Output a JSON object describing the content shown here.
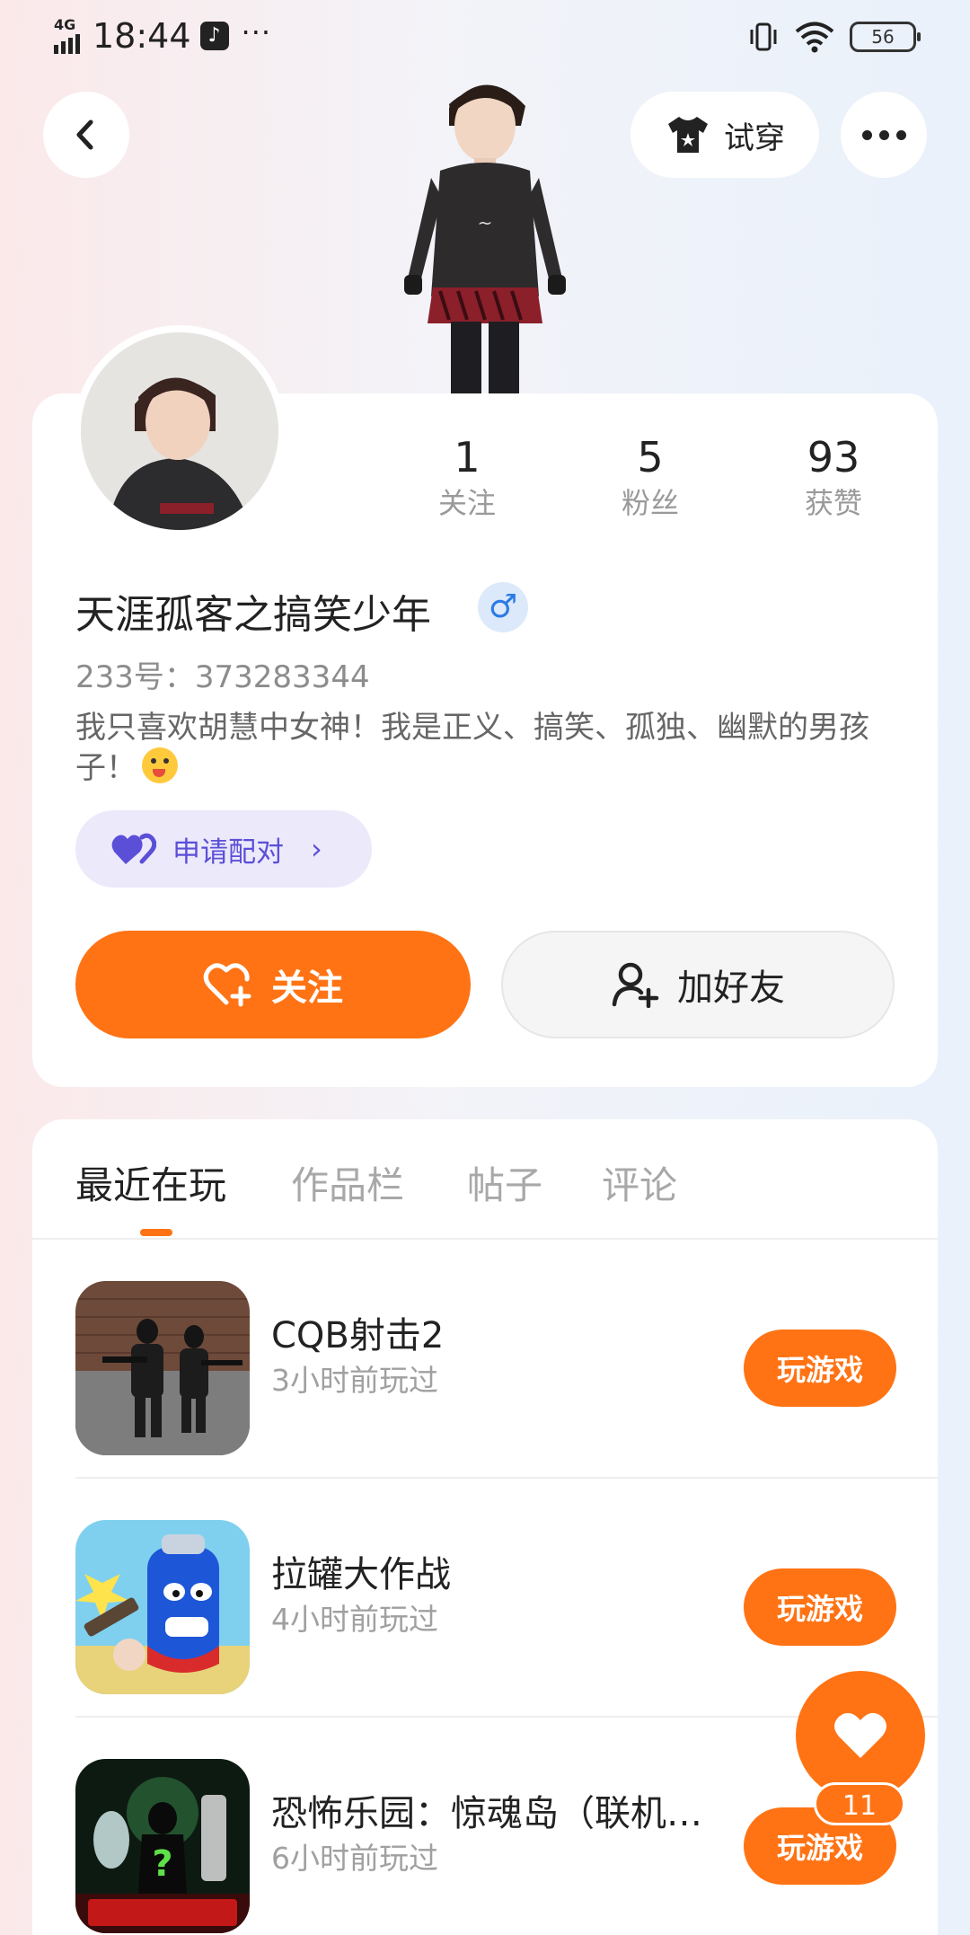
{
  "status_bar": {
    "network": "4G",
    "time": "18:44",
    "dots": "···",
    "battery": "56",
    "icons": [
      "signal-icon",
      "tiktok-icon",
      "vibrate-icon",
      "wifi-icon",
      "battery-icon"
    ]
  },
  "header": {
    "tryon_label": "试穿",
    "icons": [
      "back-arrow-icon",
      "tshirt-icon",
      "more-icon"
    ]
  },
  "profile": {
    "stats": [
      {
        "value": "1",
        "label": "关注"
      },
      {
        "value": "5",
        "label": "粉丝"
      },
      {
        "value": "93",
        "label": "获赞"
      }
    ],
    "username": "天涯孤客之搞笑少年",
    "gender_symbol": "♂",
    "uid": "233号：373283344",
    "bio": "我只喜欢胡慧中女神！我是正义、搞笑、孤独、幽默的男孩子！",
    "pair_label": "申请配对",
    "follow_label": "关注",
    "add_friend_label": "加好友"
  },
  "tabs": [
    "最近在玩",
    "作品栏",
    "帖子",
    "评论"
  ],
  "games": [
    {
      "name": "CQB射击2",
      "time": "3小时前玩过",
      "button": "玩游戏"
    },
    {
      "name": "拉罐大作战",
      "time": "4小时前玩过",
      "button": "玩游戏"
    },
    {
      "name": "恐怖乐园：惊魂岛（联机…",
      "time": "6小时前玩过",
      "button": "玩游戏"
    }
  ],
  "like_count": "11",
  "colors": {
    "accent": "#ff7314",
    "pair_purple": "#5b4fd8",
    "gender_blue": "#2c7be5"
  }
}
